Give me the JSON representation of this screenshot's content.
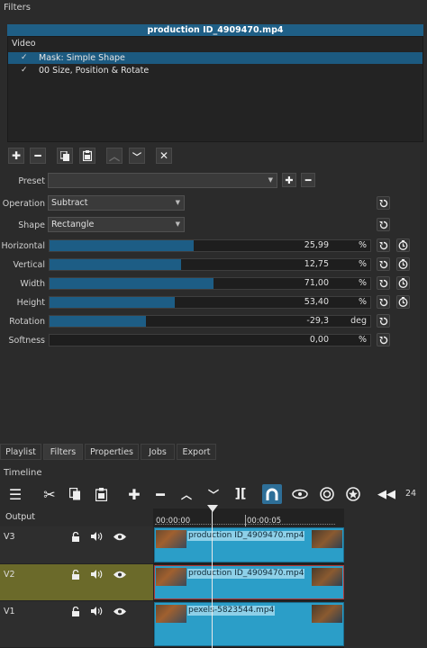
{
  "filters_panel": {
    "title": "Filters",
    "current_file": "production ID_4909470.mp4",
    "list": {
      "header": "Video",
      "items": [
        {
          "check": "✓",
          "label": "Mask: Simple Shape"
        },
        {
          "check": "✓",
          "label": "00 Size, Position & Rotate"
        }
      ]
    }
  },
  "params": {
    "preset_label": "Preset",
    "preset_value": "",
    "operation_label": "Operation",
    "operation_value": "Subtract",
    "shape_label": "Shape",
    "shape_value": "Rectangle",
    "horizontal": {
      "label": "Horizontal",
      "value": "25,99",
      "unit": "%",
      "fill_pct": 45
    },
    "vertical": {
      "label": "Vertical",
      "value": "12,75",
      "unit": "%",
      "fill_pct": 41
    },
    "width": {
      "label": "Width",
      "value": "71,00",
      "unit": "%",
      "fill_pct": 51
    },
    "height": {
      "label": "Height",
      "value": "53,40",
      "unit": "%",
      "fill_pct": 39
    },
    "rotation": {
      "label": "Rotation",
      "value": "-29,3",
      "unit": "deg",
      "fill_pct": 30
    },
    "softness": {
      "label": "Softness",
      "value": "0,00",
      "unit": "%",
      "fill_pct": 0
    }
  },
  "tabs": [
    "Playlist",
    "Filters",
    "Properties",
    "Jobs",
    "Export"
  ],
  "timeline": {
    "title": "Timeline",
    "output_label": "Output",
    "zoom_value": "24",
    "ruler": [
      "00:00:00",
      "00:00:05"
    ],
    "tracks": [
      {
        "name": "V3",
        "clip": "production ID_4909470.mp4"
      },
      {
        "name": "V2",
        "clip": "production ID_4909470.mp4"
      },
      {
        "name": "V1",
        "clip": "pexels-5823544.mp4"
      }
    ]
  },
  "colors": {
    "accent": "#1d5d85",
    "clip": "#2b9ec8",
    "selected_track": "#6b6a2a"
  },
  "icons": [
    "add-icon",
    "remove-icon",
    "copy-icon",
    "paste-icon",
    "up-icon",
    "down-icon",
    "close-icon",
    "reset-icon",
    "keyframe-icon",
    "menu-icon",
    "cut-icon",
    "append-icon",
    "lift-icon",
    "overwrite-icon",
    "split-icon",
    "snap-icon",
    "ripple-icon",
    "ripple-all-icon",
    "ripple-markers-icon",
    "zoom-out-icon"
  ]
}
